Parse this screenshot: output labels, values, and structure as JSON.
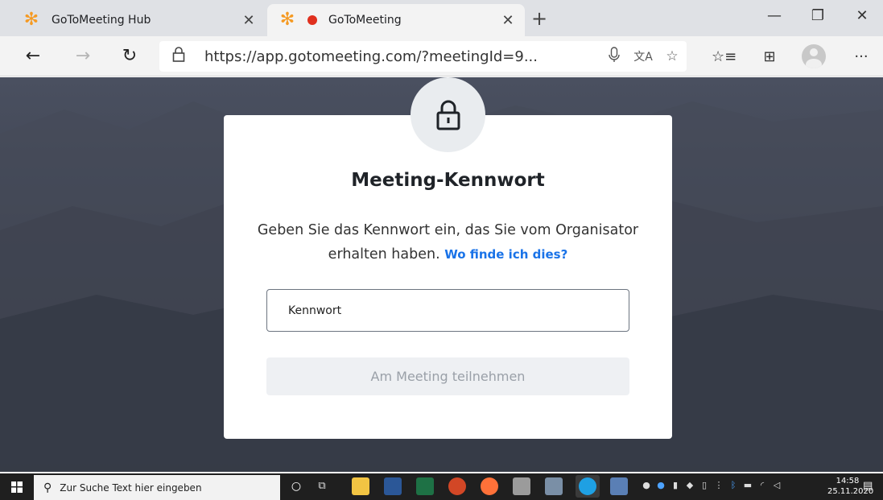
{
  "browser": {
    "tabs": [
      {
        "title": "GoToMeeting Hub",
        "active": false
      },
      {
        "title": "GoToMeeting",
        "active": true,
        "recording": true
      }
    ],
    "new_tab_icon": "plus-icon",
    "window_controls": [
      "minimize-icon",
      "restore-icon",
      "close-icon"
    ],
    "url": "https://app.gotomeeting.com/?meetingId=9...",
    "toolbar_icons": [
      "microphone-icon",
      "translate-icon",
      "favorite-star-icon",
      "favorites-list-icon",
      "collections-icon",
      "profile-avatar",
      "more-menu-icon"
    ]
  },
  "dialog": {
    "title": "Meeting-Kennwort",
    "description": "Geben Sie das Kennwort ein, das Sie vom Organisator erhalten haben.",
    "help_link": "Wo finde ich dies?",
    "password_placeholder": "Kennwort",
    "join_label": "Am Meeting teilnehmen",
    "lock_icon": "lock-icon"
  },
  "taskbar": {
    "search_placeholder": "Zur Suche Text hier eingeben",
    "time": "14:58",
    "date": "25.11.2020"
  },
  "colors": {
    "link": "#1a73e8",
    "brand_orange": "#f59a23",
    "record_red": "#e0301e",
    "background_dark": "#3f4452"
  }
}
